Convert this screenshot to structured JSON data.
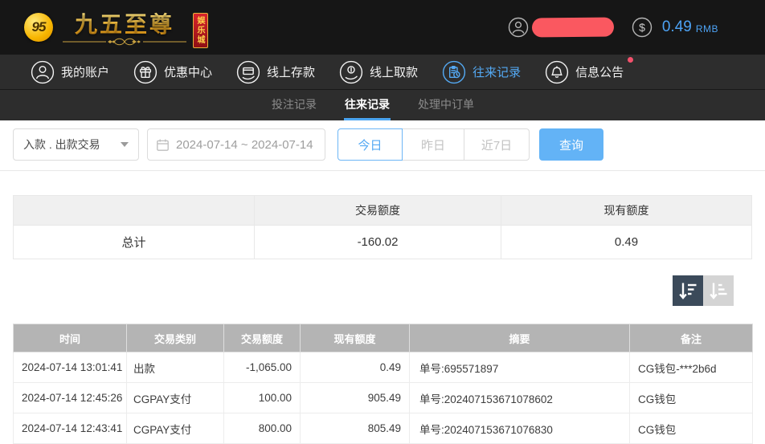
{
  "topbar": {
    "logo": {
      "monogram": "95",
      "title": "九五至尊",
      "badge": "娱乐城"
    },
    "balance": {
      "amount": "0.49",
      "currency": "RMB"
    }
  },
  "navbar": {
    "items": [
      {
        "label": "我的账户",
        "icon": "account-icon",
        "active": false
      },
      {
        "label": "优惠中心",
        "icon": "promo-icon",
        "active": false
      },
      {
        "label": "线上存款",
        "icon": "deposit-icon",
        "active": false
      },
      {
        "label": "线上取款",
        "icon": "withdraw-icon",
        "active": false
      },
      {
        "label": "往来记录",
        "icon": "records-icon",
        "active": true
      },
      {
        "label": "信息公告",
        "icon": "bell-icon",
        "active": false,
        "has_notification_dot": true
      }
    ]
  },
  "subtabs": [
    {
      "label": "投注记录",
      "active": false
    },
    {
      "label": "往来记录",
      "active": true
    },
    {
      "label": "处理中订单",
      "active": false
    }
  ],
  "filters": {
    "type_value": "入款 . 出款交易",
    "date_value": "2024-07-14 ~ 2024-07-14",
    "quick": [
      {
        "label": "今日",
        "active": true
      },
      {
        "label": "昨日",
        "active": false
      },
      {
        "label": "近7日",
        "active": false
      }
    ],
    "query_label": "查询"
  },
  "summary": {
    "headers": [
      "",
      "交易额度",
      "现有额度"
    ],
    "row": [
      "总计",
      "-160.02",
      "0.49"
    ]
  },
  "table": {
    "headers": [
      "时间",
      "交易类别",
      "交易额度",
      "现有额度",
      "摘要",
      "备注"
    ],
    "rows": [
      [
        "2024-07-14 13:01:41",
        "出款",
        "-1,065.00",
        "0.49",
        "单号:695571897",
        "CG钱包-***2b6d"
      ],
      [
        "2024-07-14 12:45:26",
        "CGPAY支付",
        "100.00",
        "905.49",
        "单号:202407153671078602",
        "CG钱包"
      ],
      [
        "2024-07-14 12:43:41",
        "CGPAY支付",
        "800.00",
        "805.49",
        "单号:202407153671076830",
        "CG钱包"
      ]
    ]
  },
  "colors": {
    "accent_blue": "#54a9f3",
    "query_button": "#63b3f6",
    "gold": "#f2c14e",
    "badge_red": "#c4161f",
    "notification_dot": "#f4516c",
    "redaction_pill": "#fa5860",
    "sort_active_bg": "#3b4a5a",
    "sort_inactive_bg": "#d4d4d4",
    "table_header_bg": "#b4b4b4"
  }
}
